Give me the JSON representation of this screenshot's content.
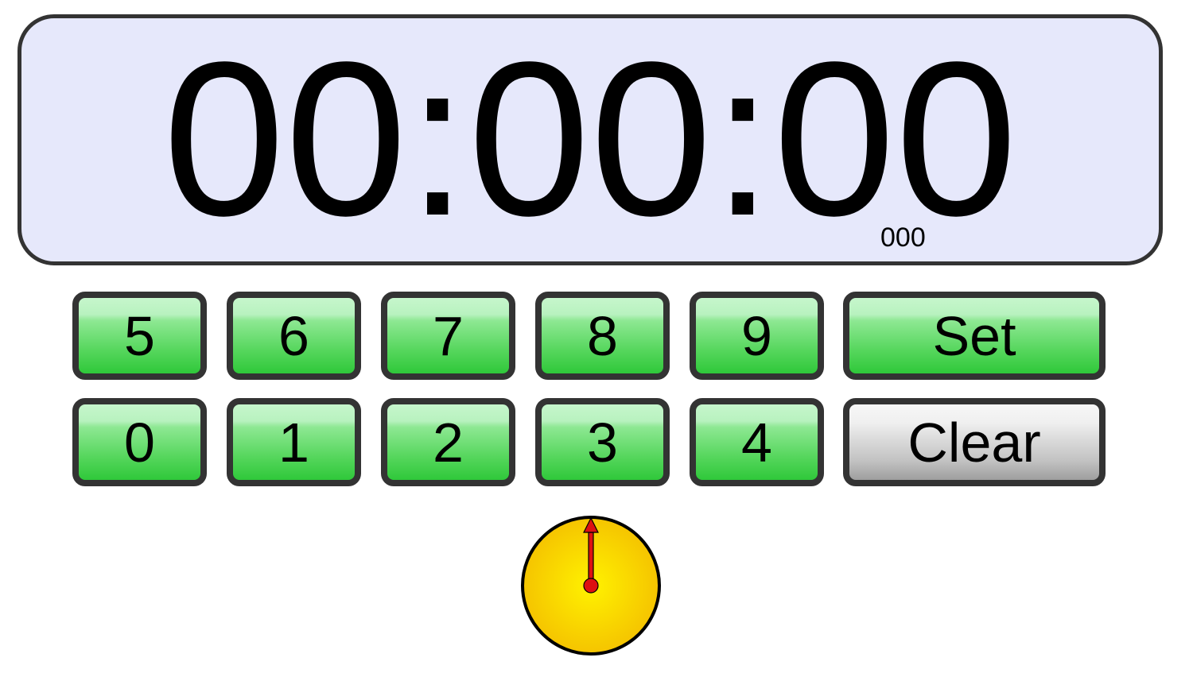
{
  "display": {
    "time": "00:00:00",
    "milliseconds": "000"
  },
  "keypad": {
    "row1": [
      "5",
      "6",
      "7",
      "8",
      "9"
    ],
    "row2": [
      "0",
      "1",
      "2",
      "3",
      "4"
    ],
    "set_label": "Set",
    "clear_label": "Clear"
  },
  "clock": {
    "hand_position_fraction": 0,
    "face_color": "#ffdd00",
    "hand_color": "#dd1111"
  },
  "colors": {
    "button_green": "#3fd148",
    "display_bg": "#e6e8fb"
  }
}
